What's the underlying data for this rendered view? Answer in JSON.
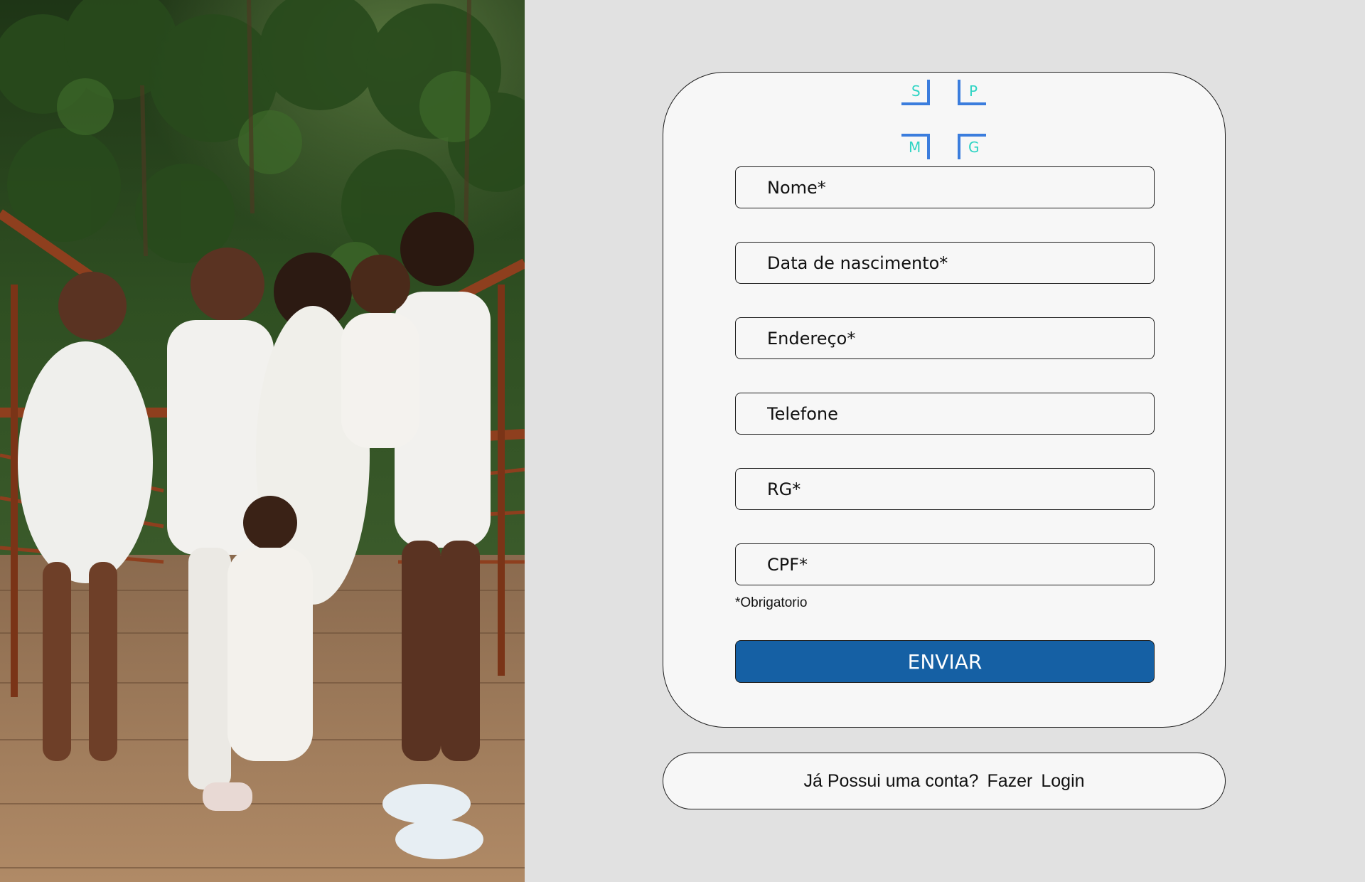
{
  "photo": {
    "subject": "family-photo"
  },
  "logo": {
    "letters": [
      "S",
      "P",
      "M",
      "G"
    ],
    "frame_color": "#3b7ddd",
    "letter_color": "#2fd4c4"
  },
  "form": {
    "fields": [
      {
        "placeholder": "Nome*"
      },
      {
        "placeholder": "Data de nascimento*"
      },
      {
        "placeholder": "Endereço*"
      },
      {
        "placeholder": "Telefone"
      },
      {
        "placeholder": "RG*"
      },
      {
        "placeholder": "CPF*"
      }
    ],
    "required_note": "*Obrigatorio",
    "submit_label": "ENVIAR",
    "submit_color": "#1560a4"
  },
  "login": {
    "question": "Já Possui uma conta?",
    "link_word1": "Fazer",
    "link_word2": "Login"
  }
}
